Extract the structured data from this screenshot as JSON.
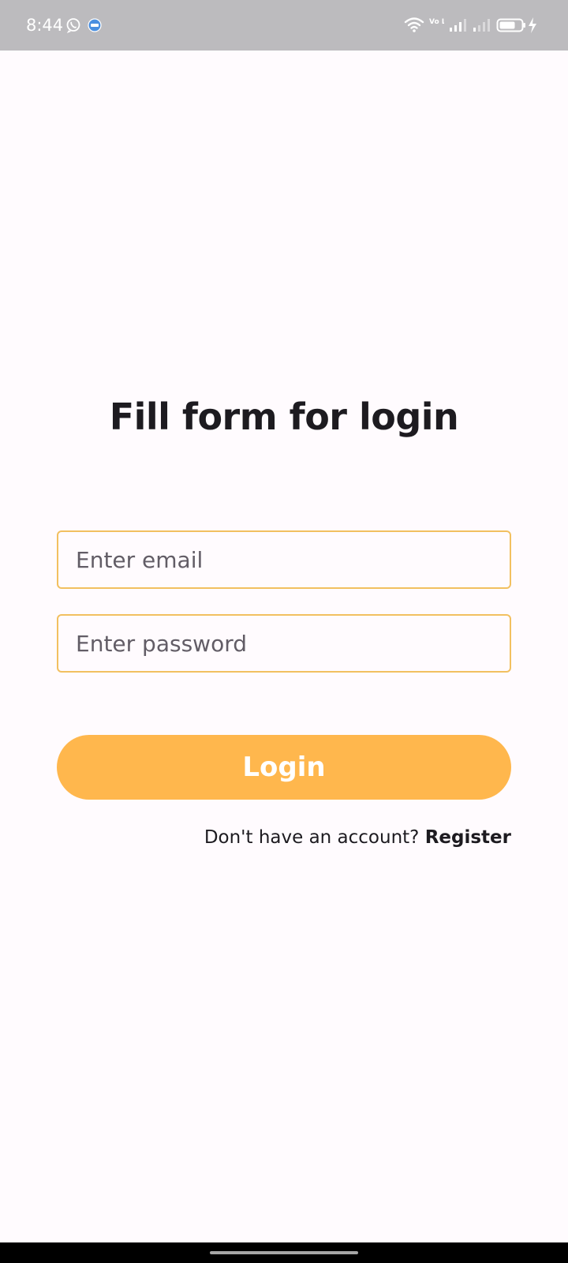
{
  "status_bar": {
    "time": "8:44",
    "icons": [
      "whatsapp-icon",
      "messages-icon",
      "wifi-icon",
      "volte-icon",
      "signal-icon",
      "signal-icon",
      "battery-icon",
      "charging-icon"
    ],
    "network_label": "Vo LTE"
  },
  "login_form": {
    "title": "Fill form for login",
    "email_placeholder": "Enter email",
    "password_placeholder": "Enter password",
    "login_label": "Login",
    "register_prompt": "Don't have an account?",
    "register_link": "Register"
  },
  "colors": {
    "background": "#fffbfe",
    "status_bar": "#bcbbbe",
    "accent": "#ffb74d",
    "field_border": "#f2c060",
    "text": "#1d1b20",
    "placeholder": "#625d66"
  }
}
